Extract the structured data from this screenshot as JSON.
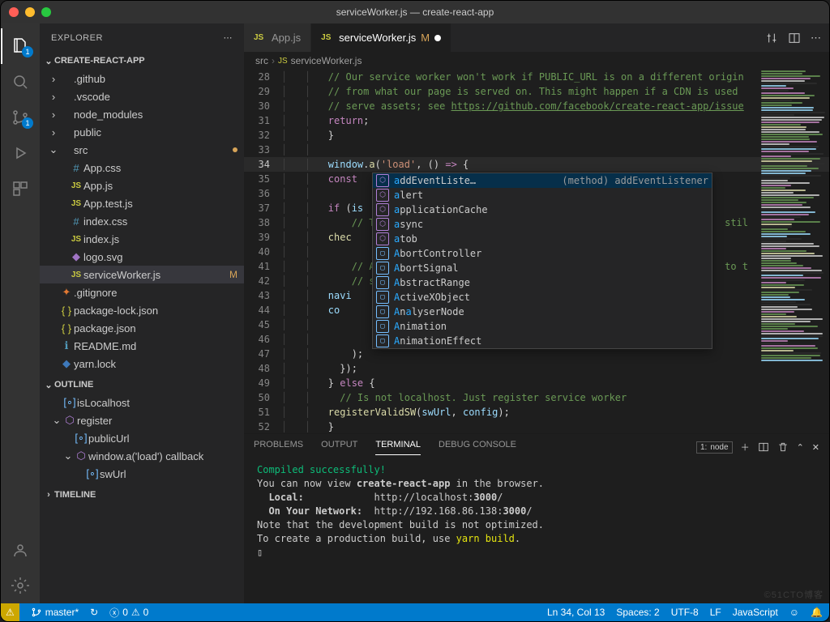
{
  "window": {
    "title": "serviceWorker.js — create-react-app"
  },
  "activity": {
    "explorerBadge": "1",
    "scmBadge": "1"
  },
  "sidebar": {
    "title": "EXPLORER",
    "project": "CREATE-REACT-APP",
    "tree": [
      {
        "depth": 0,
        "kind": "folder",
        "open": false,
        "name": ".github"
      },
      {
        "depth": 0,
        "kind": "folder",
        "open": false,
        "name": ".vscode"
      },
      {
        "depth": 0,
        "kind": "folder",
        "open": false,
        "name": "node_modules"
      },
      {
        "depth": 0,
        "kind": "folder",
        "open": false,
        "name": "public"
      },
      {
        "depth": 0,
        "kind": "folder",
        "open": true,
        "name": "src",
        "mdot": true
      },
      {
        "depth": 1,
        "kind": "css",
        "name": "App.css"
      },
      {
        "depth": 1,
        "kind": "js",
        "name": "App.js"
      },
      {
        "depth": 1,
        "kind": "js",
        "name": "App.test.js"
      },
      {
        "depth": 1,
        "kind": "css",
        "name": "index.css"
      },
      {
        "depth": 1,
        "kind": "js",
        "name": "index.js"
      },
      {
        "depth": 1,
        "kind": "svg",
        "name": "logo.svg"
      },
      {
        "depth": 1,
        "kind": "js",
        "name": "serviceWorker.js",
        "active": true,
        "m": "M"
      },
      {
        "depth": 0,
        "kind": "git",
        "name": ".gitignore"
      },
      {
        "depth": 0,
        "kind": "json",
        "name": "package-lock.json"
      },
      {
        "depth": 0,
        "kind": "json",
        "name": "package.json"
      },
      {
        "depth": 0,
        "kind": "info",
        "name": "README.md"
      },
      {
        "depth": 0,
        "kind": "yarn",
        "name": "yarn.lock"
      }
    ],
    "outlineTitle": "OUTLINE",
    "outline": [
      {
        "depth": 0,
        "icon": "var",
        "name": "isLocalhost"
      },
      {
        "depth": 0,
        "icon": "fn",
        "open": true,
        "name": "register"
      },
      {
        "depth": 1,
        "icon": "var",
        "name": "publicUrl"
      },
      {
        "depth": 1,
        "icon": "fn",
        "open": true,
        "name": "window.a('load') callback"
      },
      {
        "depth": 2,
        "icon": "var",
        "name": "swUrl"
      }
    ],
    "timelineTitle": "TIMELINE"
  },
  "tabs": [
    {
      "icon": "js",
      "label": "App.js",
      "active": false
    },
    {
      "icon": "js",
      "label": "serviceWorker.js",
      "badge": "M",
      "dirty": true,
      "active": true
    }
  ],
  "tabActionsHint": "",
  "breadcrumb": [
    "src",
    "serviceWorker.js"
  ],
  "code": {
    "firstLine": 28,
    "activeLine": 34,
    "lines": [
      {
        "t": "comment",
        "txt": "// Our service worker won't work if PUBLIC_URL is on a different origin"
      },
      {
        "t": "comment",
        "txt": "// from what our page is served on. This might happen if a CDN is used "
      },
      {
        "t": "comment",
        "txt": "// serve assets; see https://github.com/facebook/create-react-app/issue",
        "link": "https://github.com/facebook/create-react-app/issue"
      },
      {
        "t": "code",
        "html": "<span class='tok-kw'>return</span>;"
      },
      {
        "t": "code",
        "html": "}"
      },
      {
        "t": "blank"
      },
      {
        "t": "code",
        "html": "<span class='tok-id'>window</span>.<span class='tok-fn'>a</span>(<span class='tok-str'>'load'</span>, () <span class='tok-kw'>=&gt;</span> {"
      },
      {
        "t": "code",
        "html": "  <span class='tok-kw'>const</span> "
      },
      {
        "t": "blank"
      },
      {
        "t": "code",
        "html": "  <span class='tok-kw'>if</span> (<span class='tok-id'>is</span>"
      },
      {
        "t": "comment",
        "txt": "    // T",
        "tail": " stil"
      },
      {
        "t": "code",
        "html": "    <span class='tok-fn'>chec</span>"
      },
      {
        "t": "blank"
      },
      {
        "t": "comment",
        "txt": "    // A",
        "tail": " to t"
      },
      {
        "t": "comment",
        "txt": "    // s"
      },
      {
        "t": "code",
        "html": "    <span class='tok-id'>navi</span>"
      },
      {
        "t": "code",
        "html": "      <span class='tok-id'>co</span>"
      },
      {
        "t": "blank"
      },
      {
        "t": "blank"
      },
      {
        "t": "code",
        "html": "    );"
      },
      {
        "t": "code",
        "html": "  });"
      },
      {
        "t": "code",
        "html": "} <span class='tok-kw'>else</span> {"
      },
      {
        "t": "comment",
        "txt": "  // Is not localhost. Just register service worker"
      },
      {
        "t": "code",
        "html": "  <span class='tok-fn'>registerValidSW</span>(<span class='tok-id'>swUrl</span>, <span class='tok-id'>config</span>);"
      },
      {
        "t": "code",
        "html": "}"
      },
      {
        "t": "code",
        "html": "});"
      }
    ]
  },
  "suggest": {
    "detail": "(method) addEventListener<K extends k…",
    "items": [
      {
        "k": "m",
        "lbl": "addEventListe…",
        "hi": [
          0
        ],
        "sel": true
      },
      {
        "k": "m",
        "lbl": "alert",
        "hi": [
          0
        ]
      },
      {
        "k": "m",
        "lbl": "applicationCache",
        "hi": [
          0
        ]
      },
      {
        "k": "m",
        "lbl": "async",
        "hi": [
          0
        ]
      },
      {
        "k": "m",
        "lbl": "atob",
        "hi": [
          0
        ]
      },
      {
        "k": "v",
        "lbl": "AbortController",
        "hi": [
          0
        ]
      },
      {
        "k": "v",
        "lbl": "AbortSignal",
        "hi": [
          0
        ]
      },
      {
        "k": "v",
        "lbl": "AbstractRange",
        "hi": [
          0
        ]
      },
      {
        "k": "v",
        "lbl": "ActiveXObject",
        "hi": [
          0
        ]
      },
      {
        "k": "v",
        "lbl": "AnalyserNode",
        "hi": [
          0,
          2
        ]
      },
      {
        "k": "v",
        "lbl": "Animation",
        "hi": [
          0
        ]
      },
      {
        "k": "v",
        "lbl": "AnimationEffect",
        "hi": [
          0
        ]
      }
    ]
  },
  "panel": {
    "tabs": [
      "PROBLEMS",
      "OUTPUT",
      "TERMINAL",
      "DEBUG CONSOLE"
    ],
    "active": 2,
    "shell": "node",
    "lines": [
      {
        "cls": "tg",
        "txt": "Compiled successfully!"
      },
      {
        "cls": "",
        "txt": ""
      },
      {
        "cls": "",
        "txt": "You can now view <b>create-react-app</b> in the browser."
      },
      {
        "cls": "",
        "txt": ""
      },
      {
        "cls": "",
        "txt": "  <b>Local:</b>            http://localhost:<b>3000</b>/"
      },
      {
        "cls": "",
        "txt": "  <b>On Your Network:</b>  http://192.168.86.138:<b>3000</b>/"
      },
      {
        "cls": "",
        "txt": ""
      },
      {
        "cls": "",
        "txt": "Note that the development build is not optimized."
      },
      {
        "cls": "",
        "txt": "To create a production build, use <span class='ty'>yarn build</span>."
      },
      {
        "cls": "",
        "txt": ""
      },
      {
        "cls": "",
        "txt": "▯"
      }
    ]
  },
  "status": {
    "warn": "⚠",
    "branch": "master*",
    "sync": "↻",
    "errors": "0",
    "warnings": "0",
    "lncol": "Ln 34, Col 13",
    "spaces": "Spaces: 2",
    "encoding": "UTF-8",
    "eol": "LF",
    "lang": "JavaScript",
    "feedback": "☺",
    "bell": "🔔"
  },
  "watermark": "©51CTO博客"
}
